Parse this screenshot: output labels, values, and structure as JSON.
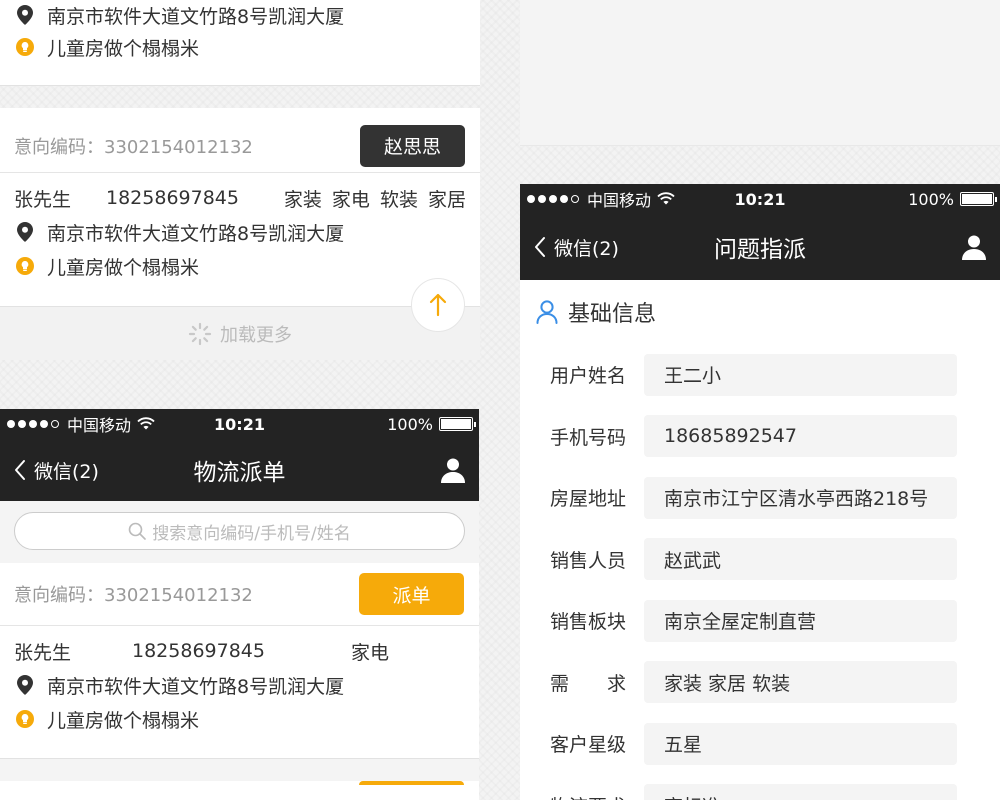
{
  "left_top": {
    "card1": {
      "address": "南京市软件大道文竹路8号凯润大厦",
      "note": "儿童房做个榻榻米"
    },
    "card2": {
      "code": "意向编码：3302154012132",
      "assignee": "赵思思",
      "name": "张先生",
      "phone": "18258697845",
      "tags": "家装  家电  软装  家居",
      "address": "南京市软件大道文竹路8号凯润大厦",
      "note": "儿童房做个榻榻米"
    },
    "load_more": "加载更多"
  },
  "left_phone": {
    "status": {
      "carrier": "中国移动",
      "time": "10:21",
      "battery": "100%"
    },
    "nav": {
      "back": "微信(2)",
      "title": "物流派单"
    },
    "search": {
      "placeholder": "搜索意向编码/手机号/姓名"
    },
    "order": {
      "code": "意向编码：3302154012132",
      "button": "派单",
      "name": "张先生",
      "phone": "18258697845",
      "tag": "家电",
      "address": "南京市软件大道文竹路8号凯润大厦",
      "note": "儿童房做个榻榻米"
    }
  },
  "right_phone": {
    "status": {
      "carrier": "中国移动",
      "time": "10:21",
      "battery": "100%"
    },
    "nav": {
      "back": "微信(2)",
      "title": "问题指派"
    },
    "section_title": "基础信息",
    "fields": [
      {
        "label": "用户姓名",
        "value": "王二小"
      },
      {
        "label": "手机号码",
        "value": "18685892547"
      },
      {
        "label": "房屋地址",
        "value": "南京市江宁区清水亭西路218号"
      },
      {
        "label": "销售人员",
        "value": "赵武武"
      },
      {
        "label": "销售板块",
        "value": "南京全屋定制直营"
      },
      {
        "label": "需　　求",
        "value": "家装  家居  软装"
      },
      {
        "label": "客户星级",
        "value": "五星"
      },
      {
        "label": "物流要求",
        "value": "高标准"
      }
    ]
  },
  "colors": {
    "accent": "#f6aa0a",
    "dark_bar": "#232323",
    "link_blue": "#3a8ee6"
  }
}
